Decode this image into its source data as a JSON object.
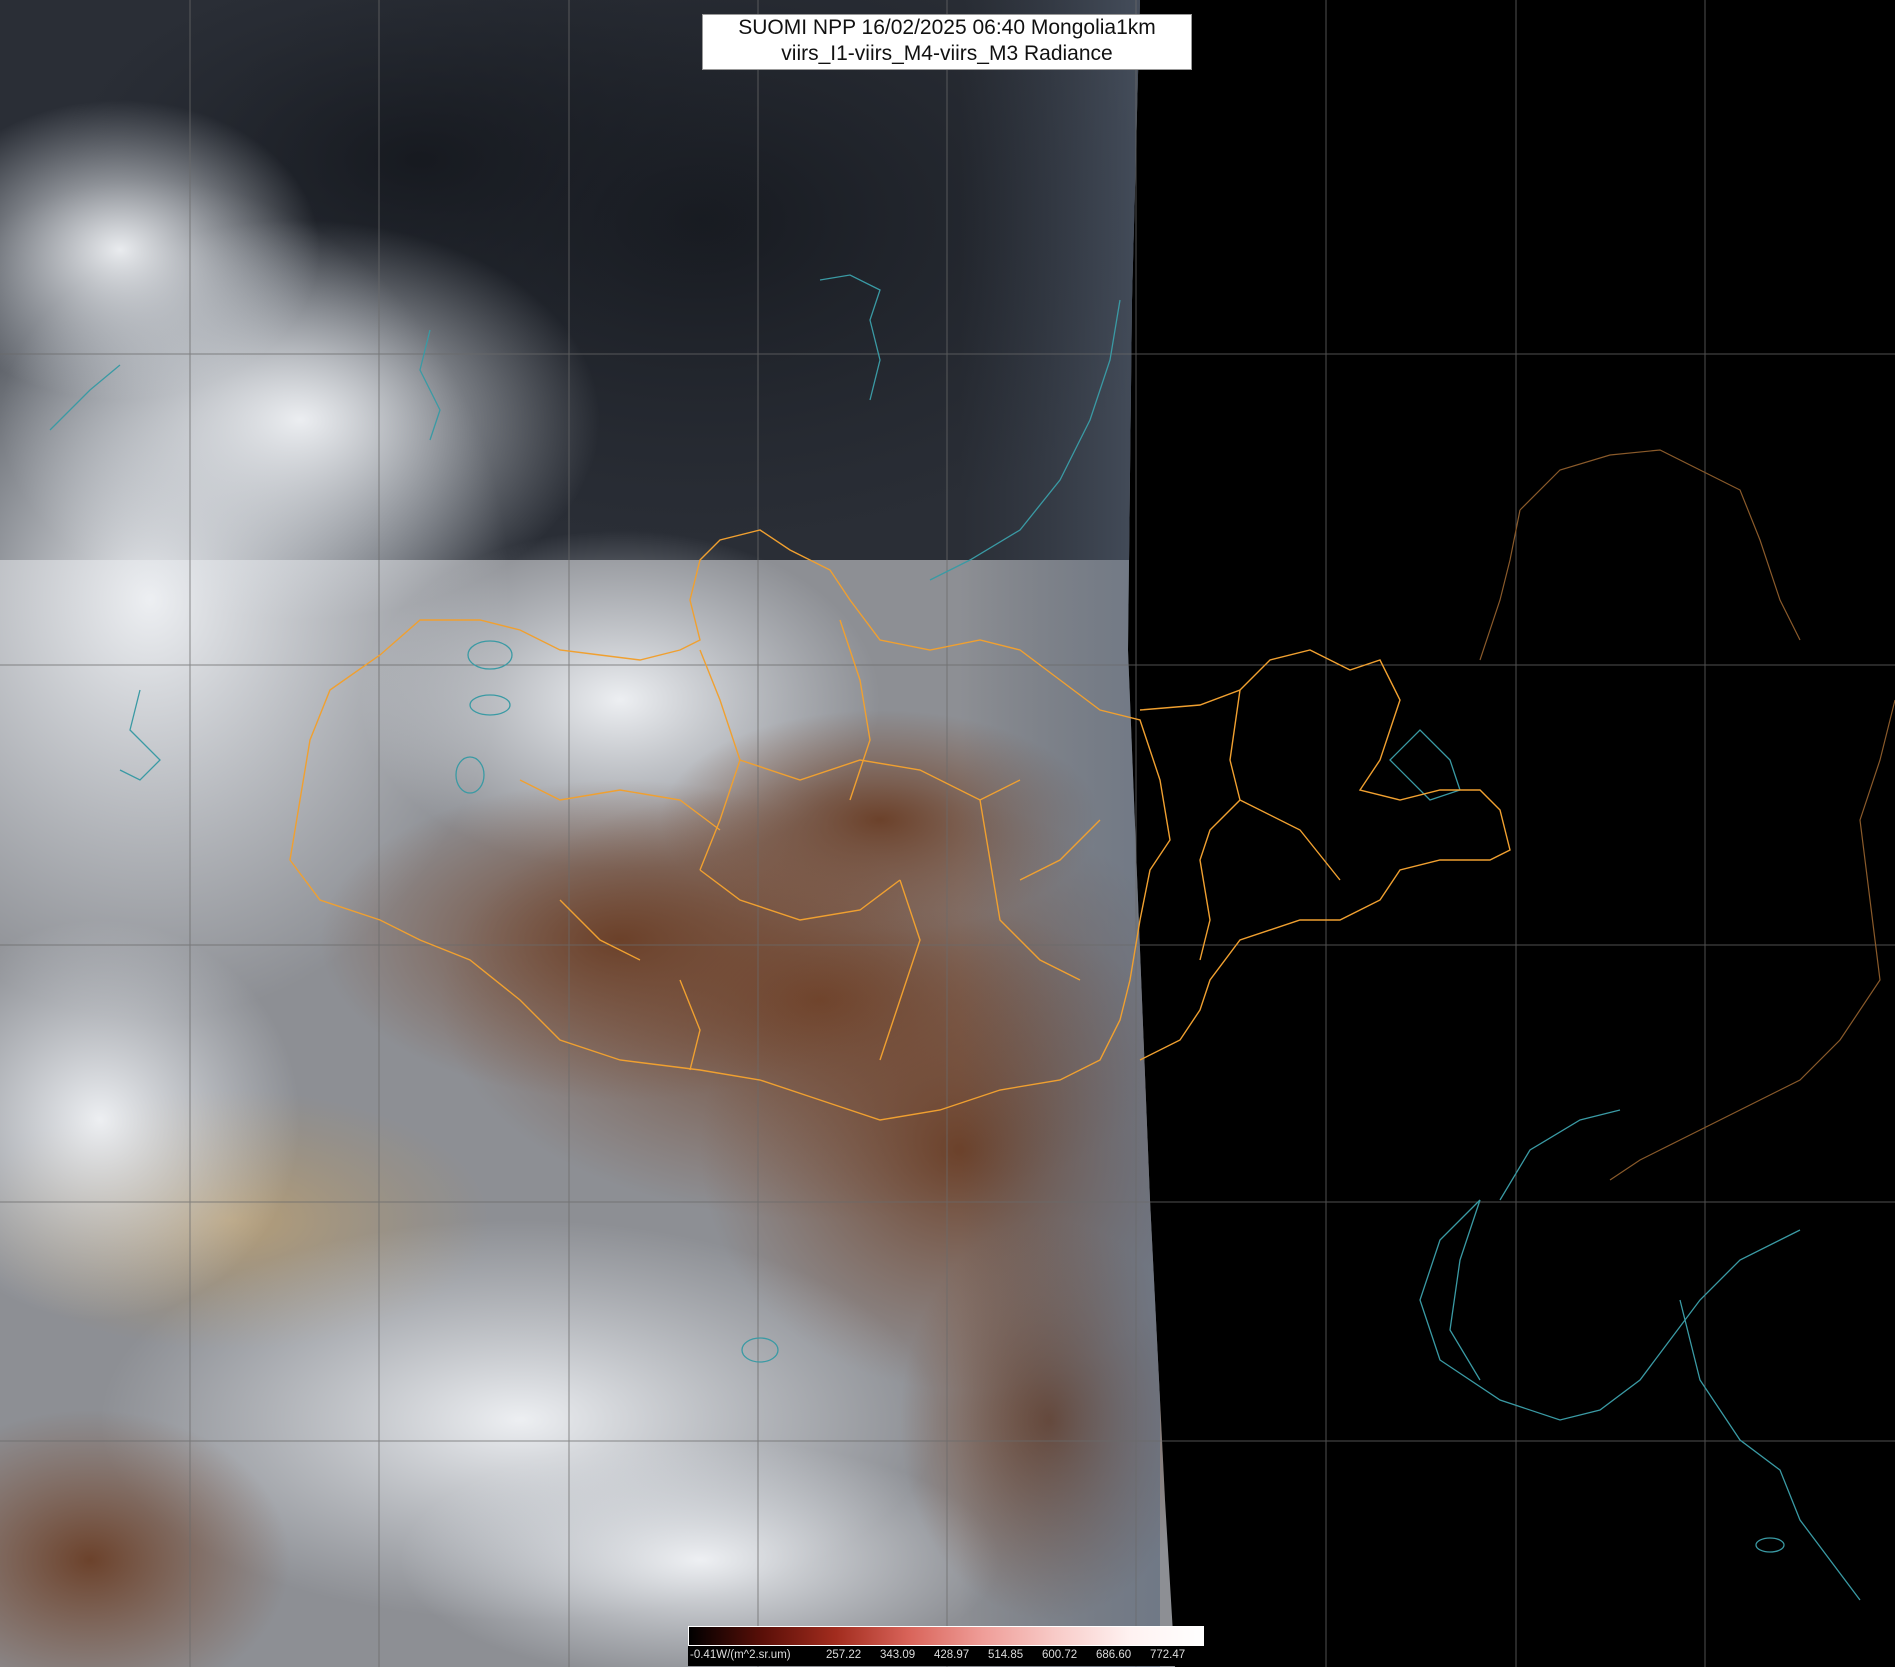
{
  "title": {
    "line1": "SUOMI NPP 16/02/2025 06:40 Mongolia1km",
    "line2": "viirs_I1-viirs_M4-viirs_M3 Radiance"
  },
  "legend": {
    "labels": [
      "-0.41W/(m^2.sr.um)",
      "257.22",
      "343.09",
      "428.97",
      "514.85",
      "600.72",
      "686.60",
      "772.47"
    ],
    "gradient_colors": [
      "#000000",
      "#5a0f08",
      "#a22c1e",
      "#d9645a",
      "#ef9d98",
      "#f8cbc8",
      "#fff2f1",
      "#ffffff"
    ]
  },
  "colors": {
    "background_night": "#000000",
    "snow_cloud": "#e4e8ee",
    "forest_dark": "#1c1f26",
    "desert_brown": "#8a5a3a",
    "sand": "#b59a72",
    "border_orange": "#f0a030",
    "coast_teal": "#3a9aa4",
    "grid_gray": "#6a6a6a"
  }
}
